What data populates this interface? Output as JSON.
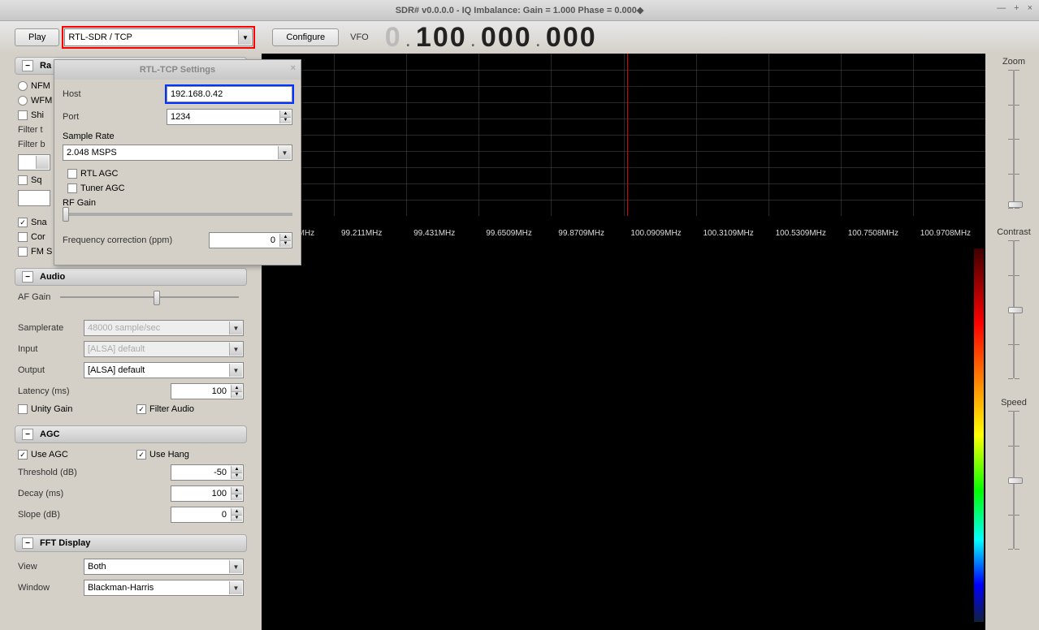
{
  "window": {
    "title": "SDR# v0.0.0.0 - IQ Imbalance: Gain = 1.000 Phase = 0.000◆"
  },
  "toolbar": {
    "play_label": "Play",
    "source_selected": "RTL-SDR / TCP",
    "configure_label": "Configure",
    "vfo_label": "VFO"
  },
  "frequency": {
    "d0": "0",
    "d1": "1",
    "d2": "0",
    "d3": "0",
    "d4": "0",
    "d5": "0",
    "d6": "0",
    "d7": "0",
    "d8": "0",
    "d9": "0"
  },
  "radio_section": {
    "title": "Ra"
  },
  "modes": {
    "nfm": "NFM",
    "wfm": "WFM",
    "shi": "Shi",
    "filter_t": "Filter t",
    "filter_b": "Filter b",
    "sq_label": "Sq",
    "snap": "Sna",
    "cor": "Cor",
    "fm_s": "FM S"
  },
  "audio": {
    "title": "Audio",
    "af_gain": "AF Gain",
    "samplerate_label": "Samplerate",
    "samplerate_value": "48000 sample/sec",
    "input_label": "Input",
    "input_value": "[ALSA] default",
    "output_label": "Output",
    "output_value": "[ALSA] default",
    "latency_label": "Latency (ms)",
    "latency_value": "100",
    "unity_gain": "Unity Gain",
    "filter_audio": "Filter Audio"
  },
  "agc": {
    "title": "AGC",
    "use_agc": "Use AGC",
    "use_hang": "Use Hang",
    "threshold_label": "Threshold (dB)",
    "threshold_value": "-50",
    "decay_label": "Decay (ms)",
    "decay_value": "100",
    "slope_label": "Slope (dB)",
    "slope_value": "0"
  },
  "fft": {
    "title": "FFT Display",
    "view_label": "View",
    "view_value": "Both",
    "window_label": "Window",
    "window_value": "Blackman-Harris"
  },
  "spectrum_labels": {
    "f0": "MHz",
    "f1": "99.211MHz",
    "f2": "99.431MHz",
    "f3": "99.6509MHz",
    "f4": "99.8709MHz",
    "f5": "100.0909MHz",
    "f6": "100.3109MHz",
    "f7": "100.5309MHz",
    "f8": "100.7508MHz",
    "f9": "100.9708MHz"
  },
  "right_sliders": {
    "zoom": "Zoom",
    "contrast": "Contrast",
    "speed": "Speed"
  },
  "dialog": {
    "title": "RTL-TCP Settings",
    "host_label": "Host",
    "host_value": "192.168.0.42",
    "port_label": "Port",
    "port_value": "1234",
    "sample_rate_label": "Sample Rate",
    "sample_rate_value": "2.048 MSPS",
    "rtl_agc": "RTL AGC",
    "tuner_agc": "Tuner AGC",
    "rf_gain": "RF Gain",
    "freq_corr_label": "Frequency correction (ppm)",
    "freq_corr_value": "0"
  }
}
